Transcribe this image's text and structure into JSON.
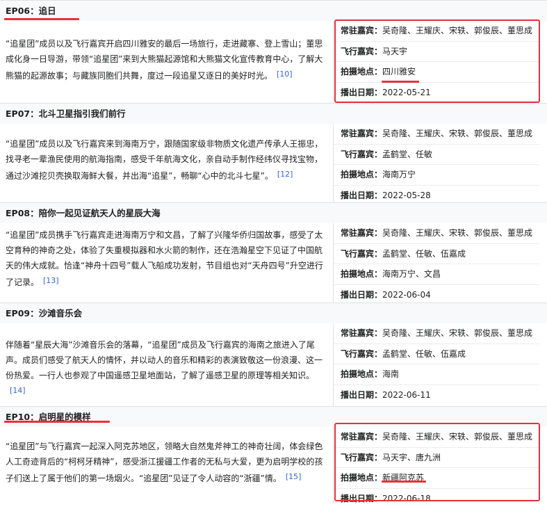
{
  "episodes": [
    {
      "title": "EP06：追日",
      "desc": "“追星团”成员以及飞行嘉宾开启四川雅安的最后一场旅行，走进藏寨、登上雪山；董思成化身一日导游，带领“追星团”来到大熊猫起源馆和大熊猫文化宣传教育中心，了解大熊猫的起源故事；与藏族同胞们共舞，度过一段追星又逐日的美好时光。",
      "ref": "[10]",
      "regular_label": "常驻嘉宾：",
      "regular": "吴奇隆、王耀庆、宋轶、郭俊辰、董思成",
      "guest_label": "飞行嘉宾：",
      "guest": "马天宇",
      "location_label": "拍摄地点：",
      "location": "四川雅安",
      "date_label": "播出日期：",
      "date": "2022-05-21"
    },
    {
      "title": "EP07：北斗卫星指引我们前行",
      "desc": "“追星团”成员以及飞行嘉宾来到海南万宁，跟随国家级非物质文化遗产传承人王振忠，找寻老一辈渔民使用的航海指南，感受千年航海文化，亲自动手制作经纬仪寻找宝物，通过沙滩挖贝壳换取海鲜大餐，并出海“追星”，畅聊“心中的北斗七星”。",
      "ref": "[12]",
      "regular_label": "常驻嘉宾：",
      "regular": "吴奇隆、王耀庆、宋轶、郭俊辰、董思成",
      "guest_label": "飞行嘉宾：",
      "guest": "孟鹤堂、任敏",
      "location_label": "拍摄地点：",
      "location": "海南万宁",
      "date_label": "播出日期：",
      "date": "2022-05-28"
    },
    {
      "title": "EP08：陪你一起见证航天人的星辰大海",
      "desc": "“追星团”成员携手飞行嘉宾走进海南万宁和文昌，了解了兴隆华侨归国故事，感受了太空育种的神奇之处，体验了失重模拟器和水火箭的制作，还在浩瀚星空下见证了中国航天的伟大成就。恰逢“神舟十四号”载人飞船成功发射，节目组也对“天舟四号”升空进行了记录。",
      "ref": "[13]",
      "regular_label": "常驻嘉宾：",
      "regular": "吴奇隆、王耀庆、宋轶、郭俊辰、董思成",
      "guest_label": "飞行嘉宾：",
      "guest": "孟鹤堂、任敏、伍嘉成",
      "location_label": "拍摄地点：",
      "location": "海南万宁、文昌",
      "date_label": "播出日期：",
      "date": "2022-06-04"
    },
    {
      "title": "EP09：沙滩音乐会",
      "desc": "伴随着“星辰大海”沙滩音乐会的落幕，“追星团”成员及飞行嘉宾的海南之旅进入了尾声。成员们感受了航天人的情怀，并以动人的音乐和精彩的表演致敬这一份浪漫、这一份热爱。一行人也参观了中国遥感卫星地面站，了解了遥感卫星的原理等相关知识。",
      "ref": "[14]",
      "regular_label": "常驻嘉宾：",
      "regular": "吴奇隆、王耀庆、宋轶、郭俊辰、董思成",
      "guest_label": "飞行嘉宾：",
      "guest": "孟鹤堂、任敏、伍嘉成",
      "location_label": "拍摄地点：",
      "location": "海南",
      "date_label": "播出日期：",
      "date": "2022-06-11"
    },
    {
      "title": "EP10：启明星的模样",
      "desc": "“追星团”与飞行嘉宾一起深入阿克苏地区，领略大自然鬼斧神工的神奇壮阔，体会绿色人工奇迹背后的“柯柯牙精神”，感受浙江援疆工作者的无私与大爱，更为启明学校的孩子们送上了属于他们的第一场烟火。“追星团”见证了令人动容的“浙疆”情。",
      "ref": "[15]",
      "regular_label": "常驻嘉宾：",
      "regular": "吴奇隆、王耀庆、宋轶、郭俊辰、董思成",
      "guest_label": "飞行嘉宾：",
      "guest": "马天宇、唐九洲",
      "location_label": "拍摄地点：",
      "location": "新疆阿克苏",
      "date_label": "播出日期：",
      "date": "2022-06-18"
    }
  ],
  "colors": {
    "highlight": "#e8303a",
    "link": "#3366cc",
    "header_bg": "#f8f9fa"
  }
}
